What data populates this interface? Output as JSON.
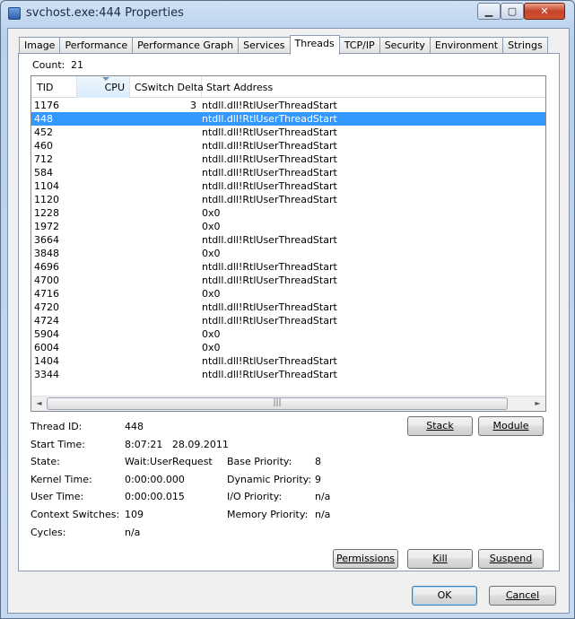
{
  "window": {
    "title": "svchost.exe:444 Properties",
    "min_glyph": "▁",
    "max_glyph": "▢",
    "close_glyph": "✕"
  },
  "tabs": [
    {
      "label": "Image"
    },
    {
      "label": "Performance"
    },
    {
      "label": "Performance Graph"
    },
    {
      "label": "Services"
    },
    {
      "label": "Threads",
      "active": true
    },
    {
      "label": "TCP/IP"
    },
    {
      "label": "Security"
    },
    {
      "label": "Environment"
    },
    {
      "label": "Strings"
    }
  ],
  "threads": {
    "count_label": "Count:",
    "count_value": "21",
    "columns": {
      "tid": "TID",
      "cpu": "CPU",
      "cswitch": "CSwitch Delta",
      "start": "Start Address"
    },
    "rows": [
      {
        "tid": "1176",
        "cpu": "",
        "cswitch": "3",
        "start": "ntdll.dll!RtlUserThreadStart"
      },
      {
        "tid": "448",
        "cpu": "",
        "cswitch": "",
        "start": "ntdll.dll!RtlUserThreadStart",
        "selected": true
      },
      {
        "tid": "452",
        "cpu": "",
        "cswitch": "",
        "start": "ntdll.dll!RtlUserThreadStart"
      },
      {
        "tid": "460",
        "cpu": "",
        "cswitch": "",
        "start": "ntdll.dll!RtlUserThreadStart"
      },
      {
        "tid": "712",
        "cpu": "",
        "cswitch": "",
        "start": "ntdll.dll!RtlUserThreadStart"
      },
      {
        "tid": "584",
        "cpu": "",
        "cswitch": "",
        "start": "ntdll.dll!RtlUserThreadStart"
      },
      {
        "tid": "1104",
        "cpu": "",
        "cswitch": "",
        "start": "ntdll.dll!RtlUserThreadStart"
      },
      {
        "tid": "1120",
        "cpu": "",
        "cswitch": "",
        "start": "ntdll.dll!RtlUserThreadStart"
      },
      {
        "tid": "1228",
        "cpu": "",
        "cswitch": "",
        "start": "0x0"
      },
      {
        "tid": "1972",
        "cpu": "",
        "cswitch": "",
        "start": "0x0"
      },
      {
        "tid": "3664",
        "cpu": "",
        "cswitch": "",
        "start": "ntdll.dll!RtlUserThreadStart"
      },
      {
        "tid": "3848",
        "cpu": "",
        "cswitch": "",
        "start": "0x0"
      },
      {
        "tid": "4696",
        "cpu": "",
        "cswitch": "",
        "start": "ntdll.dll!RtlUserThreadStart"
      },
      {
        "tid": "4700",
        "cpu": "",
        "cswitch": "",
        "start": "ntdll.dll!RtlUserThreadStart"
      },
      {
        "tid": "4716",
        "cpu": "",
        "cswitch": "",
        "start": "0x0"
      },
      {
        "tid": "4720",
        "cpu": "",
        "cswitch": "",
        "start": "ntdll.dll!RtlUserThreadStart"
      },
      {
        "tid": "4724",
        "cpu": "",
        "cswitch": "",
        "start": "ntdll.dll!RtlUserThreadStart"
      },
      {
        "tid": "5904",
        "cpu": "",
        "cswitch": "",
        "start": "0x0"
      },
      {
        "tid": "6004",
        "cpu": "",
        "cswitch": "",
        "start": "0x0"
      },
      {
        "tid": "1404",
        "cpu": "",
        "cswitch": "",
        "start": "ntdll.dll!RtlUserThreadStart"
      },
      {
        "tid": "3344",
        "cpu": "",
        "cswitch": "",
        "start": "ntdll.dll!RtlUserThreadStart"
      }
    ],
    "scroll_left": "◄",
    "scroll_right": "►",
    "scroll_grip": "|||"
  },
  "details": {
    "thread_id_label": "Thread ID:",
    "thread_id": "448",
    "start_time_label": "Start Time:",
    "start_time": "8:07:21   28.09.2011",
    "state_label": "State:",
    "state": "Wait:UserRequest",
    "kernel_time_label": "Kernel Time:",
    "kernel_time": "0:00:00.000",
    "user_time_label": "User Time:",
    "user_time": "0:00:00.015",
    "context_switches_label": "Context Switches:",
    "context_switches": "109",
    "cycles_label": "Cycles:",
    "cycles": "n/a",
    "base_priority_label": "Base Priority:",
    "base_priority": "8",
    "dynamic_priority_label": "Dynamic Priority:",
    "dynamic_priority": "9",
    "io_priority_label": "I/O Priority:",
    "io_priority": "n/a",
    "memory_priority_label": "Memory Priority:",
    "memory_priority": "n/a"
  },
  "buttons": {
    "stack": "Stack",
    "module": "Module",
    "permissions": "Permissions",
    "kill": "Kill",
    "suspend": "Suspend",
    "ok": "OK",
    "cancel": "Cancel"
  }
}
